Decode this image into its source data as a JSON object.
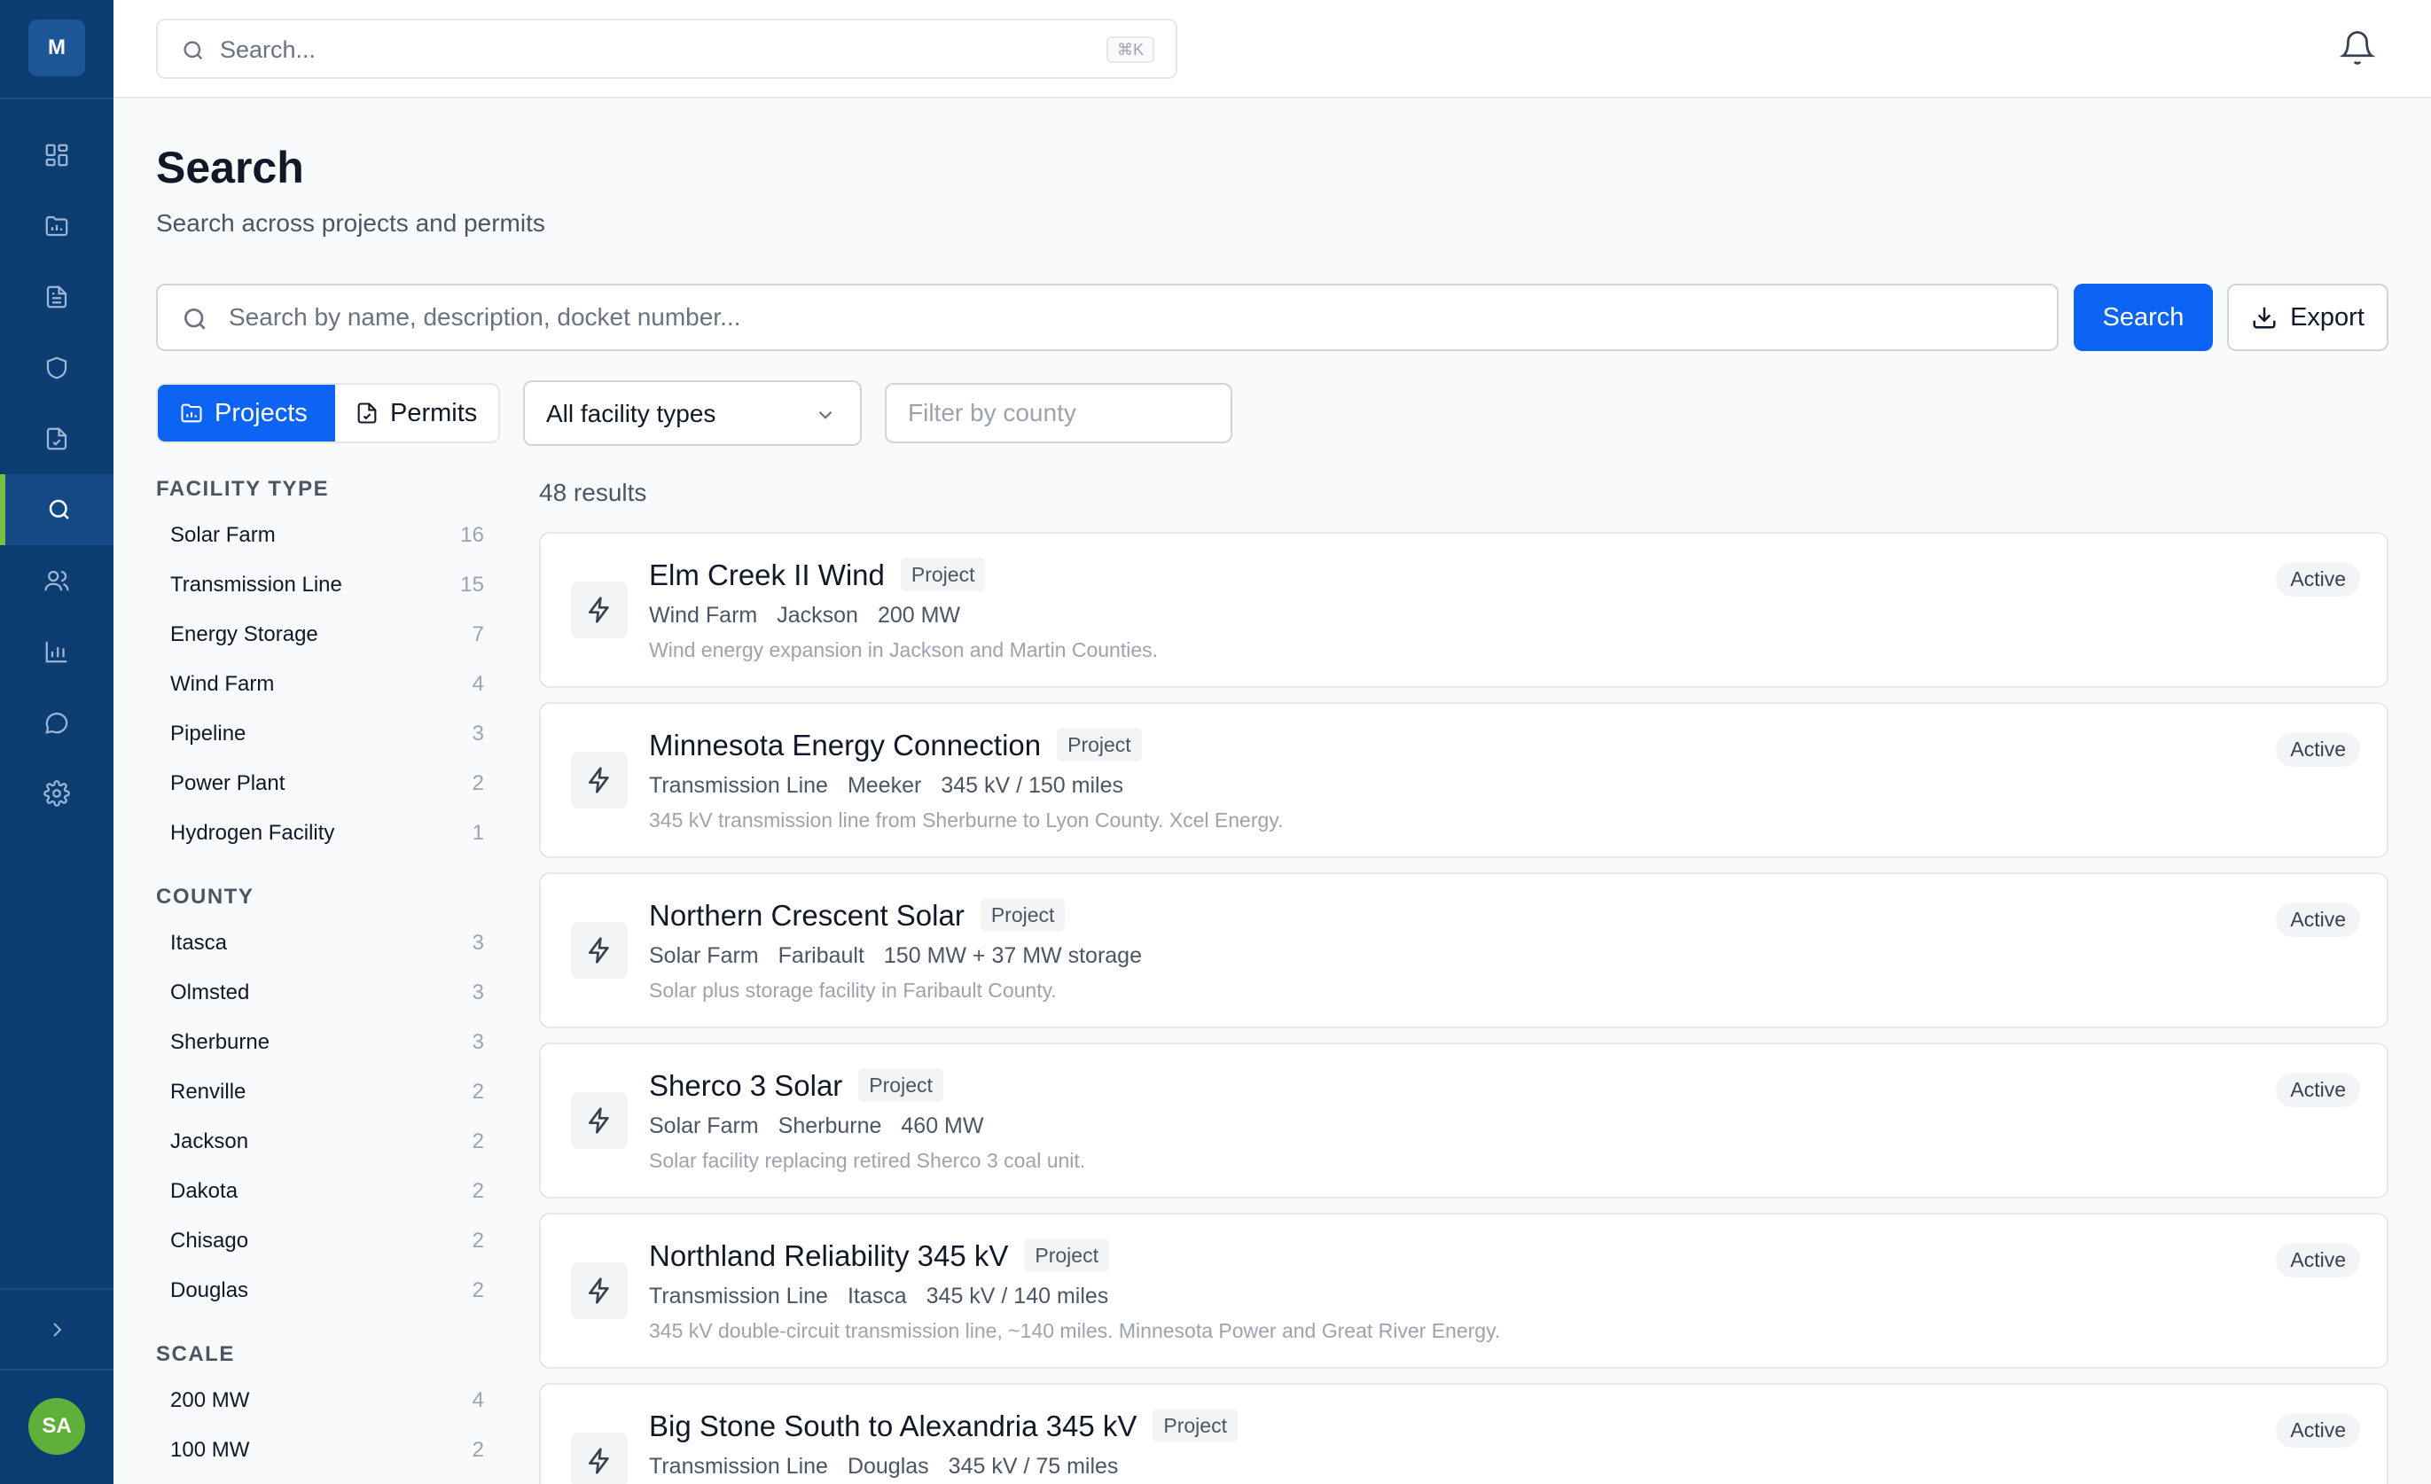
{
  "app": {
    "logo_letter": "M",
    "user_initials": "SA"
  },
  "topbar": {
    "search_placeholder": "Search...",
    "shortcut": "⌘K"
  },
  "page": {
    "title": "Search",
    "subtitle": "Search across projects and permits"
  },
  "search": {
    "placeholder": "Search by name, description, docket number...",
    "button_label": "Search",
    "export_label": "Export"
  },
  "toggle": {
    "projects_label": "Projects",
    "permits_label": "Permits"
  },
  "filters": {
    "facility_select": "All facility types",
    "county_placeholder": "Filter by county"
  },
  "results_count": "48 results",
  "facets": {
    "facility_type": {
      "heading": "FACILITY TYPE",
      "items": [
        {
          "label": "Solar Farm",
          "count": "16"
        },
        {
          "label": "Transmission Line",
          "count": "15"
        },
        {
          "label": "Energy Storage",
          "count": "7"
        },
        {
          "label": "Wind Farm",
          "count": "4"
        },
        {
          "label": "Pipeline",
          "count": "3"
        },
        {
          "label": "Power Plant",
          "count": "2"
        },
        {
          "label": "Hydrogen Facility",
          "count": "1"
        }
      ]
    },
    "county": {
      "heading": "COUNTY",
      "items": [
        {
          "label": "Itasca",
          "count": "3"
        },
        {
          "label": "Olmsted",
          "count": "3"
        },
        {
          "label": "Sherburne",
          "count": "3"
        },
        {
          "label": "Renville",
          "count": "2"
        },
        {
          "label": "Jackson",
          "count": "2"
        },
        {
          "label": "Dakota",
          "count": "2"
        },
        {
          "label": "Chisago",
          "count": "2"
        },
        {
          "label": "Douglas",
          "count": "2"
        }
      ]
    },
    "scale": {
      "heading": "SCALE",
      "items": [
        {
          "label": "200 MW",
          "count": "4"
        },
        {
          "label": "100 MW",
          "count": "2"
        }
      ]
    }
  },
  "results": [
    {
      "title": "Elm Creek II Wind",
      "badge": "Project",
      "facility": "Wind Farm",
      "county": "Jackson",
      "scale": "200 MW",
      "description": "Wind energy expansion in Jackson and Martin Counties.",
      "status": "Active"
    },
    {
      "title": "Minnesota Energy Connection",
      "badge": "Project",
      "facility": "Transmission Line",
      "county": "Meeker",
      "scale": "345 kV / 150 miles",
      "description": "345 kV transmission line from Sherburne to Lyon County. Xcel Energy.",
      "status": "Active"
    },
    {
      "title": "Northern Crescent Solar",
      "badge": "Project",
      "facility": "Solar Farm",
      "county": "Faribault",
      "scale": "150 MW + 37 MW storage",
      "description": "Solar plus storage facility in Faribault County.",
      "status": "Active"
    },
    {
      "title": "Sherco 3 Solar",
      "badge": "Project",
      "facility": "Solar Farm",
      "county": "Sherburne",
      "scale": "460 MW",
      "description": "Solar facility replacing retired Sherco 3 coal unit.",
      "status": "Active"
    },
    {
      "title": "Northland Reliability 345 kV",
      "badge": "Project",
      "facility": "Transmission Line",
      "county": "Itasca",
      "scale": "345 kV / 140 miles",
      "description": "345 kV double-circuit transmission line, ~140 miles. Minnesota Power and Great River Energy.",
      "status": "Active"
    },
    {
      "title": "Big Stone South to Alexandria 345 kV",
      "badge": "Project",
      "facility": "Transmission Line",
      "county": "Douglas",
      "scale": "345 kV / 75 miles",
      "description": "",
      "status": "Active"
    }
  ]
}
